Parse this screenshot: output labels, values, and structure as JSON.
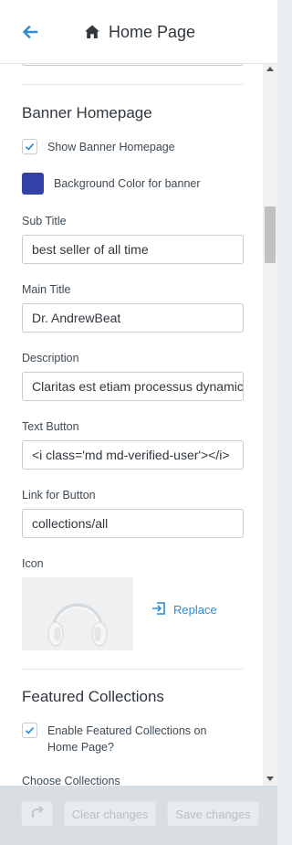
{
  "header": {
    "title": "Home Page",
    "back_icon": "arrow-left-icon",
    "home_icon": "home-icon"
  },
  "banner": {
    "heading": "Banner Homepage",
    "show_banner": {
      "label": "Show Banner Homepage",
      "checked": true
    },
    "background_color": {
      "label": "Background Color for banner",
      "value": "#3341a9"
    },
    "sub_title": {
      "label": "Sub Title",
      "value": "best seller of all time"
    },
    "main_title": {
      "label": "Main Title",
      "value": "Dr. AndrewBeat"
    },
    "description": {
      "label": "Description",
      "value": "Claritas est etiam processus dynamicus"
    },
    "text_button": {
      "label": "Text Button",
      "value": "<i class='md md-verified-user'></i>"
    },
    "link_button": {
      "label": "Link for Button",
      "value": "collections/all"
    },
    "icon": {
      "label": "Icon",
      "image": "headphones-image",
      "replace_label": "Replace",
      "replace_icon": "replace-icon"
    }
  },
  "featured": {
    "heading": "Featured Collections",
    "enable": {
      "label": "Enable Featured Collections on Home Page?",
      "checked": true
    },
    "choose_label": "Choose Collections"
  },
  "footer": {
    "redo_icon": "redo-icon",
    "clear_label": "Clear changes",
    "save_label": "Save changes"
  },
  "colors": {
    "accent": "#2d8bd3",
    "text": "#3d4a55"
  }
}
